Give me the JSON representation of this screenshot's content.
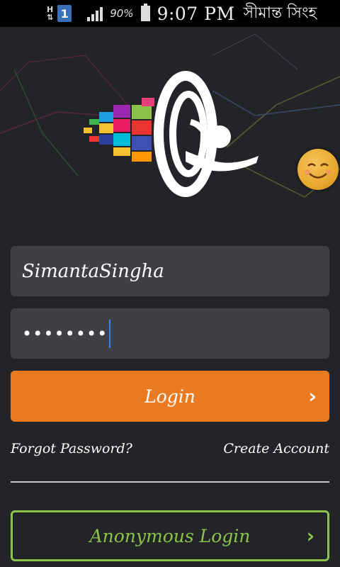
{
  "status_bar": {
    "network_letter": "H",
    "sim_slot": "1",
    "battery_percent": "90%",
    "time": "9:07 PM",
    "operator_name": "সীমান্ত সিংহ"
  },
  "login_form": {
    "username_value": "SimantaSingha",
    "password_masked": "••••••••"
  },
  "buttons": {
    "login_label": "Login",
    "anonymous_label": "Anonymous Login"
  },
  "links": {
    "forgot_password": "Forgot Password?",
    "create_account": "Create Account"
  },
  "colors": {
    "background": "#232427",
    "accent_orange": "#ea7a1f",
    "accent_green": "#8bc34a",
    "field_bg": "#3e4046"
  },
  "icons": [
    "signal-icon",
    "battery-icon",
    "chevron-right-icon",
    "app-logo",
    "smiley-emoji-icon"
  ]
}
